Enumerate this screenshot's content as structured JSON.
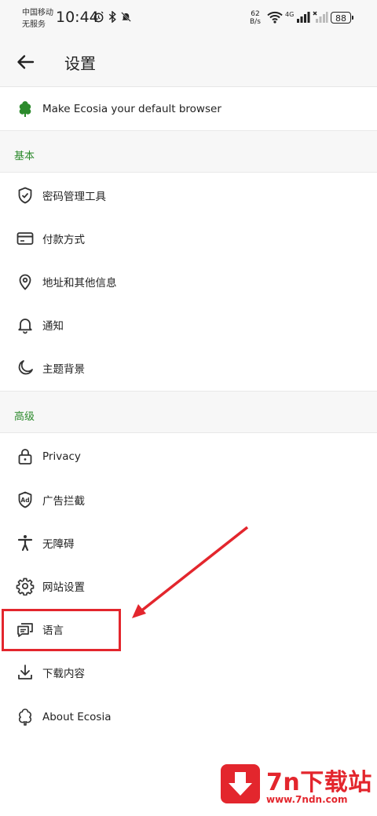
{
  "status_bar": {
    "carrier_line1": "中国移动",
    "carrier_line2": "无服务",
    "time": "10:44",
    "speed_value": "62",
    "speed_unit": "B/s",
    "network": "4G",
    "battery": "88"
  },
  "appbar": {
    "title": "设置"
  },
  "default_browser": {
    "label": "Make Ecosia your default browser",
    "icon": "ecosia-tree-icon"
  },
  "sections": {
    "basic": {
      "header": "基本",
      "items": [
        {
          "label": "密码管理工具",
          "icon": "shield-check-icon"
        },
        {
          "label": "付款方式",
          "icon": "credit-card-icon"
        },
        {
          "label": "地址和其他信息",
          "icon": "location-pin-icon"
        },
        {
          "label": "通知",
          "icon": "bell-icon"
        },
        {
          "label": "主题背景",
          "icon": "moon-icon"
        }
      ]
    },
    "advanced": {
      "header": "高级",
      "items": [
        {
          "label": "Privacy",
          "icon": "lock-icon"
        },
        {
          "label": "广告拦截",
          "icon": "ad-shield-icon"
        },
        {
          "label": "无障碍",
          "icon": "accessibility-icon"
        },
        {
          "label": "网站设置",
          "icon": "gear-icon"
        },
        {
          "label": "语言",
          "icon": "chat-bubbles-icon"
        },
        {
          "label": "下载内容",
          "icon": "download-icon"
        },
        {
          "label": "About Ecosia",
          "icon": "tree-outline-icon"
        }
      ]
    }
  },
  "watermark": {
    "text": "7n下载站",
    "url": "www.7ndn.com"
  },
  "colors": {
    "accent_green": "#2c8a2c",
    "annotation_red": "#e3262d",
    "background": "#ffffff",
    "section_bg": "#f7f7f7"
  }
}
